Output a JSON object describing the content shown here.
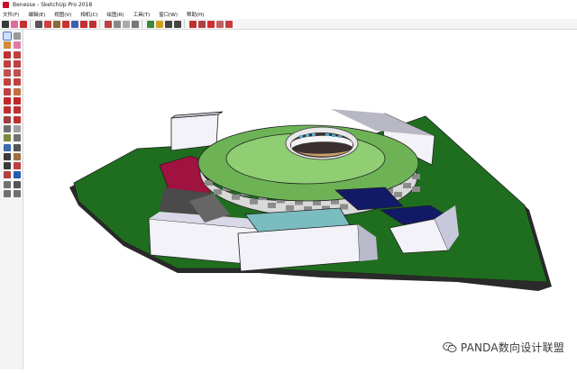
{
  "window": {
    "title": "Benesse - SketchUp Pro 2018"
  },
  "menu": {
    "items": [
      "文件(F)",
      "编辑(E)",
      "视图(V)",
      "相机(C)",
      "绘图(R)",
      "工具(T)",
      "窗口(W)",
      "帮助(H)"
    ]
  },
  "toolbar": {
    "buttons": [
      {
        "icon": "select-arrow-icon",
        "color": "#3a3a3a"
      },
      {
        "icon": "eraser-icon",
        "color": "#e06aa0"
      },
      {
        "icon": "pencil-icon",
        "color": "#c03030"
      },
      {
        "icon": "line-icon",
        "color": "#555555"
      },
      {
        "icon": "rotate-icon",
        "color": "#d04040"
      },
      {
        "icon": "paint-bucket-icon",
        "color": "#8a6a3a"
      },
      {
        "icon": "move-icon",
        "color": "#c83232"
      },
      {
        "icon": "push-pull-icon",
        "color": "#3d5fb0"
      },
      {
        "icon": "offset-icon",
        "color": "#c03030"
      },
      {
        "icon": "scale-icon",
        "color": "#c03030"
      },
      {
        "icon": "follow-me-icon",
        "color": "#b84040"
      },
      {
        "icon": "tape-measure-icon",
        "color": "#888888"
      },
      {
        "icon": "protractor-icon",
        "color": "#aaaaaa"
      },
      {
        "icon": "text-icon",
        "color": "#777777"
      },
      {
        "icon": "axes-icon",
        "color": "#3a8a3a"
      },
      {
        "icon": "orbit-icon",
        "color": "#d0a020"
      },
      {
        "icon": "pan-icon",
        "color": "#444444"
      },
      {
        "icon": "zoom-icon",
        "color": "#444444"
      },
      {
        "icon": "zoom-extents-icon",
        "color": "#c03030"
      },
      {
        "icon": "warehouse-icon",
        "color": "#b04040"
      },
      {
        "icon": "extension-icon",
        "color": "#d03030"
      },
      {
        "icon": "layout-icon",
        "color": "#c06060"
      },
      {
        "icon": "style-builder-icon",
        "color": "#c83c3c"
      }
    ]
  },
  "sidebar": {
    "tools": [
      {
        "icon": "select-icon",
        "color": "#2a2a2a"
      },
      {
        "icon": "make-component-icon",
        "color": "#999999"
      },
      {
        "icon": "paint-icon",
        "color": "#d48a3a"
      },
      {
        "icon": "eraser-icon",
        "color": "#e07aa8"
      },
      {
        "icon": "line-icon",
        "color": "#c03030"
      },
      {
        "icon": "freehand-icon",
        "color": "#c04040"
      },
      {
        "icon": "rectangle-icon",
        "color": "#c04040"
      },
      {
        "icon": "rotated-rect-icon",
        "color": "#c04040"
      },
      {
        "icon": "circle-icon",
        "color": "#c05050"
      },
      {
        "icon": "polygon-icon",
        "color": "#c05050"
      },
      {
        "icon": "arc-icon",
        "color": "#c04040"
      },
      {
        "icon": "pie-icon",
        "color": "#c04040"
      },
      {
        "icon": "arc3-icon",
        "color": "#c04040"
      },
      {
        "icon": "arc2-icon",
        "color": "#c07040"
      },
      {
        "icon": "move-icon",
        "color": "#c02828"
      },
      {
        "icon": "push-pull-icon",
        "color": "#c02828"
      },
      {
        "icon": "rotate-icon",
        "color": "#c03030"
      },
      {
        "icon": "follow-me-icon",
        "color": "#c03030"
      },
      {
        "icon": "scale-icon",
        "color": "#a04040"
      },
      {
        "icon": "offset-icon",
        "color": "#c03030"
      },
      {
        "icon": "tape-icon",
        "color": "#707070"
      },
      {
        "icon": "dimension-icon",
        "color": "#a0a0a0"
      },
      {
        "icon": "protractor-icon",
        "color": "#7a8a3a"
      },
      {
        "icon": "text-icon",
        "color": "#707070"
      },
      {
        "icon": "axes-icon",
        "color": "#3a6ab0"
      },
      {
        "icon": "3d-text-icon",
        "color": "#555555"
      },
      {
        "icon": "orbit-icon",
        "color": "#3a3a3a"
      },
      {
        "icon": "pan-icon",
        "color": "#a07040"
      },
      {
        "icon": "zoom-icon",
        "color": "#3a3a3a"
      },
      {
        "icon": "zoom-window-icon",
        "color": "#c04040"
      },
      {
        "icon": "zoom-extents-icon",
        "color": "#b04040"
      },
      {
        "icon": "previous-icon",
        "color": "#2060b0"
      },
      {
        "icon": "position-camera-icon",
        "color": "#707070"
      },
      {
        "icon": "look-around-icon",
        "color": "#555555"
      },
      {
        "icon": "walk-icon",
        "color": "#707070"
      },
      {
        "icon": "section-plane-icon",
        "color": "#707070"
      }
    ]
  },
  "colors": {
    "ground": "#1f6e1f",
    "ground_shadow": "#2a2a2a",
    "roof": "#6db356",
    "roof_inner": "#8fce73",
    "wall_light": "#d9d9d9",
    "wall_dark": "#8c8c8c",
    "box_white": "#f2f2f8",
    "magenta": "#a0123f",
    "teal": "#7bbcc0",
    "navy": "#111a66"
  },
  "watermark": {
    "text": "PANDA数向设计联盟",
    "icon": "wechat-icon"
  }
}
